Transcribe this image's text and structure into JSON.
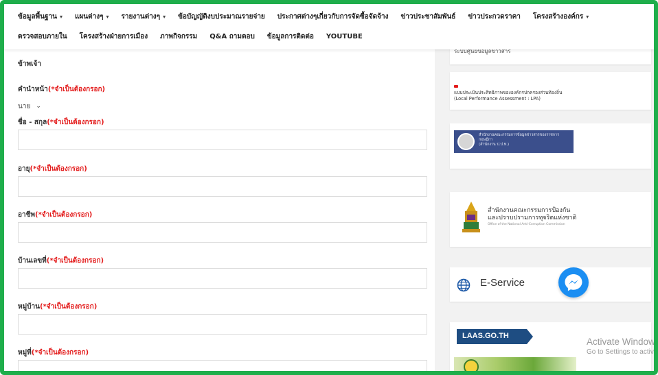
{
  "nav": {
    "row1": [
      {
        "label": "ข้อมูลพื้นฐาน",
        "dropdown": true
      },
      {
        "label": "แผนต่างๆ",
        "dropdown": true
      },
      {
        "label": "รายงานต่างๆ",
        "dropdown": true
      },
      {
        "label": "ข้อบัญญัติงบประมาณรายจ่าย",
        "dropdown": false
      },
      {
        "label": "ประกาศต่างๆเกี่ยวกับการจัดซื้อจัดจ้าง",
        "dropdown": false
      },
      {
        "label": "ข่าวประชาสัมพันธ์",
        "dropdown": false
      },
      {
        "label": "ข่าวประกวดราคา",
        "dropdown": false
      },
      {
        "label": "โครงสร้างองค์กร",
        "dropdown": true
      }
    ],
    "row2": [
      {
        "label": "ตรวจสอบภายใน"
      },
      {
        "label": "โครงสร้างฝ่ายการเมือง"
      },
      {
        "label": "ภาพกิจกรรม"
      },
      {
        "label": "Q&A ถามตอบ"
      },
      {
        "label": "ข้อมูลการติดต่อ"
      },
      {
        "label": "YOUTUBE"
      }
    ],
    "caret": "▾"
  },
  "form": {
    "heading": "ข้าพเจ้า",
    "required_text": "(*จำเป็นต้องกรอก)",
    "prefix": {
      "label": "คำนำหน้า",
      "value": "นาย"
    },
    "fields": [
      {
        "label": "ชื่อ - สกุล",
        "value": ""
      },
      {
        "label": "อายุ",
        "value": ""
      },
      {
        "label": "อาชีพ",
        "value": ""
      },
      {
        "label": "บ้านเลขที่",
        "value": ""
      },
      {
        "label": "หมู่บ้าน",
        "value": ""
      },
      {
        "label": "หมู่ที่",
        "value": ""
      }
    ]
  },
  "sidebar": {
    "card1_text": "ระบบศูนย์ข้อมูลข่าวสาร",
    "lpa": {
      "line1": "แบบประเมินประสิทธิภาพขององค์กรปกครองส่วนท้องถิ่น",
      "line2": "(Local Performance Assessment : LPA)"
    },
    "dla": {
      "line1": "สำนักงานคณะกรรมการข้อมูลข่าวสารของราชการ",
      "line2": "กฤษฎีกา",
      "line3": "(สำนักงาน ป.ป.ท.)"
    },
    "nacc": {
      "line1": "สำนักงานคณะกรรมการป้องกัน",
      "line2": "และปราบปรามการทุจริตแห่งชาติ",
      "sub": "Office of the National Anti-Corruption Commission"
    },
    "eservice_label": "E-Service",
    "laas_label": "LAAS.GO.TH"
  },
  "watermark": {
    "line1": "Activate Windows",
    "line2": "Go to Settings to activate Windows."
  },
  "colors": {
    "frame": "#1fae4b",
    "required": "#e31b1b",
    "messenger": "#1b8ef2",
    "laas": "#1e4d82"
  }
}
